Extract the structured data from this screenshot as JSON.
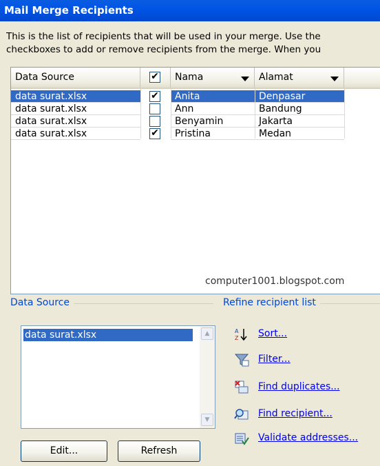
{
  "window": {
    "title": "Mail Merge Recipients"
  },
  "description": {
    "line1": "This is the list of recipients that will be used in your merge.  Use the",
    "line2": "checkboxes to add or remove recipients from the merge.  When you"
  },
  "grid": {
    "headers": {
      "source": "Data Source",
      "name": "Nama",
      "address": "Alamat"
    },
    "rows": [
      {
        "source": "data surat.xlsx",
        "checked": true,
        "name": "Anita",
        "address": "Denpasar",
        "selected": true
      },
      {
        "source": "data surat.xlsx",
        "checked": false,
        "name": "Ann",
        "address": "Bandung",
        "selected": false
      },
      {
        "source": "data surat.xlsx",
        "checked": false,
        "name": "Benyamin",
        "address": "Jakarta",
        "selected": false
      },
      {
        "source": "data surat.xlsx",
        "checked": true,
        "name": "Pristina",
        "address": "Medan",
        "selected": false
      }
    ],
    "header_checked": true,
    "check_mark": "✔",
    "watermark": "computer1001.blogspot.com"
  },
  "data_source": {
    "label": "Data Source",
    "items": [
      "data surat.xlsx"
    ],
    "edit_label": "Edit...",
    "refresh_label": "Refresh"
  },
  "refine": {
    "label": "Refine recipient list",
    "links": [
      {
        "label": "Sort...",
        "icon": "sort-az-icon"
      },
      {
        "label": "Filter...",
        "icon": "filter-funnel-icon"
      },
      {
        "label": "Find duplicates...",
        "icon": "find-duplicates-icon"
      },
      {
        "label": "Find recipient...",
        "icon": "find-recipient-icon"
      },
      {
        "label": "Validate addresses...",
        "icon": "validate-addresses-icon"
      }
    ]
  },
  "colors": {
    "title_bar": "#0055e5",
    "selection": "#316ac5",
    "group_label": "#0046d5",
    "link": "#0000ee"
  }
}
